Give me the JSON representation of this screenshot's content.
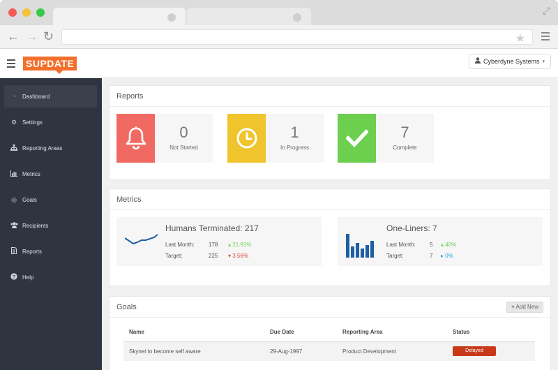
{
  "colors": {
    "brand": "#f36f2b",
    "not_started": "#f06a63",
    "in_progress": "#f0c42c",
    "complete": "#6ccf4e",
    "chart_blue": "#1e5fa3",
    "delayed": "#c8391a"
  },
  "app": {
    "logo": "SUPDATE",
    "account": "Cyberdyne Systems"
  },
  "sidebar": {
    "items": [
      {
        "label": "Dashboard",
        "icon": "dashboard-icon"
      },
      {
        "label": "Settings",
        "icon": "gears-icon"
      },
      {
        "label": "Reporting Areas",
        "icon": "sitemap-icon"
      },
      {
        "label": "Metrics",
        "icon": "bar-chart-icon"
      },
      {
        "label": "Goals",
        "icon": "target-icon"
      },
      {
        "label": "Recipients",
        "icon": "users-icon"
      },
      {
        "label": "Reports",
        "icon": "document-icon"
      },
      {
        "label": "Help",
        "icon": "help-icon"
      }
    ]
  },
  "reports": {
    "title": "Reports",
    "stats": [
      {
        "value": "0",
        "label": "Not Started"
      },
      {
        "value": "1",
        "label": "In Progress"
      },
      {
        "value": "7",
        "label": "Complete"
      }
    ]
  },
  "metrics": {
    "title": "Metrics",
    "cards": [
      {
        "title": "Humans Terminated: 217",
        "rows": [
          {
            "label": "Last Month:",
            "value": "178",
            "delta": "21.91%",
            "direction": "up"
          },
          {
            "label": "Target:",
            "value": "225",
            "delta": "3.56%",
            "direction": "down"
          }
        ]
      },
      {
        "title": "One-Liners: 7",
        "rows": [
          {
            "label": "Last Month:",
            "value": "5",
            "delta": "40%",
            "direction": "up"
          },
          {
            "label": "Target:",
            "value": "7",
            "delta": "0%",
            "direction": "flat"
          }
        ]
      }
    ]
  },
  "goals": {
    "title": "Goals",
    "add_new": "Add New",
    "columns": [
      "Name",
      "Due Date",
      "Reporting Area",
      "Status"
    ],
    "rows": [
      {
        "name": "Skynet to become self aware",
        "due": "29-Aug-1997",
        "area": "Product Development",
        "status": "Delayed"
      }
    ]
  }
}
